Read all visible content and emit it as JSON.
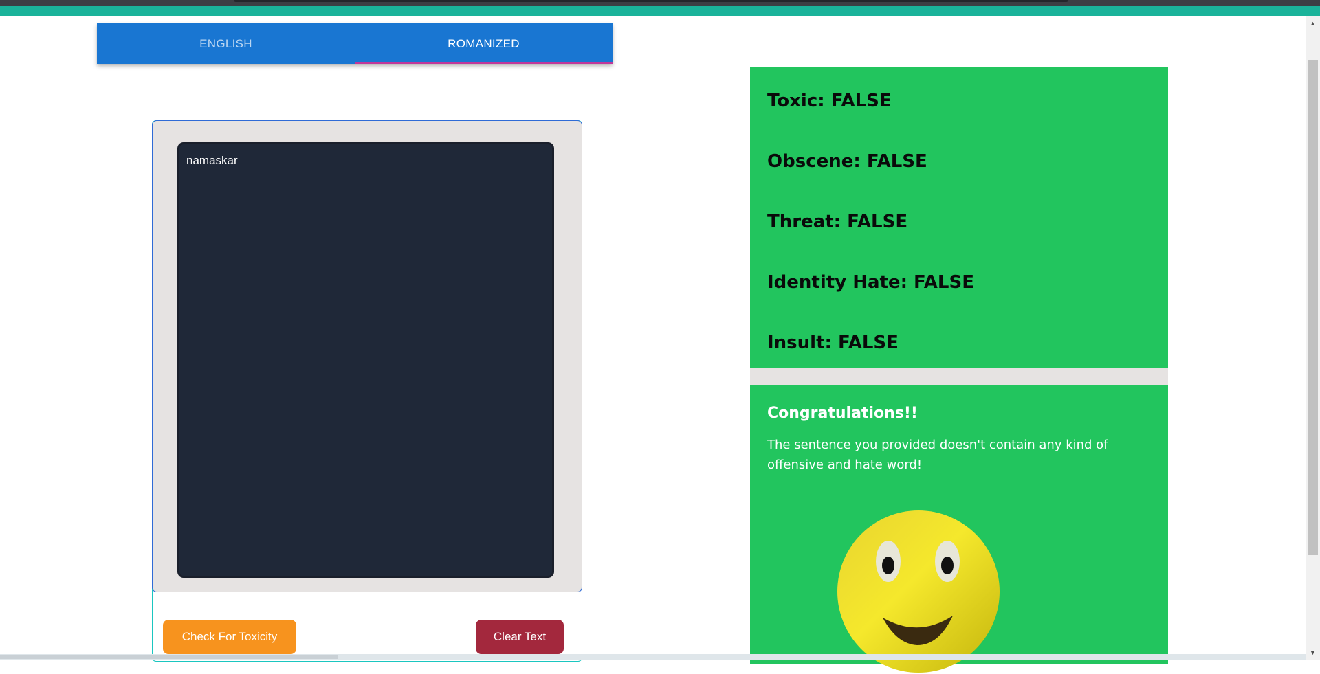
{
  "tabs": [
    {
      "label": "ENGLISH",
      "active": false
    },
    {
      "label": "ROMANIZED",
      "active": true
    }
  ],
  "input": {
    "value": "namaskar"
  },
  "buttons": {
    "check_label": "Check For Toxicity",
    "clear_label": "Clear Text"
  },
  "results": [
    {
      "label": "Toxic: FALSE"
    },
    {
      "label": "Obscene: FALSE"
    },
    {
      "label": "Threat: FALSE"
    },
    {
      "label": "Identity Hate: FALSE"
    },
    {
      "label": "Insult: FALSE"
    }
  ],
  "verdict": {
    "title": "Congratulations!!",
    "message": "The sentence you provided doesn't contain any kind of offensive and hate word!",
    "icon": "smiley-face-icon"
  },
  "colors": {
    "tab_bar": "#1976d2",
    "result_panel": "#22c55e",
    "check_button": "#f7931e",
    "clear_button": "#a3283d",
    "input_bg": "#1f2838"
  }
}
